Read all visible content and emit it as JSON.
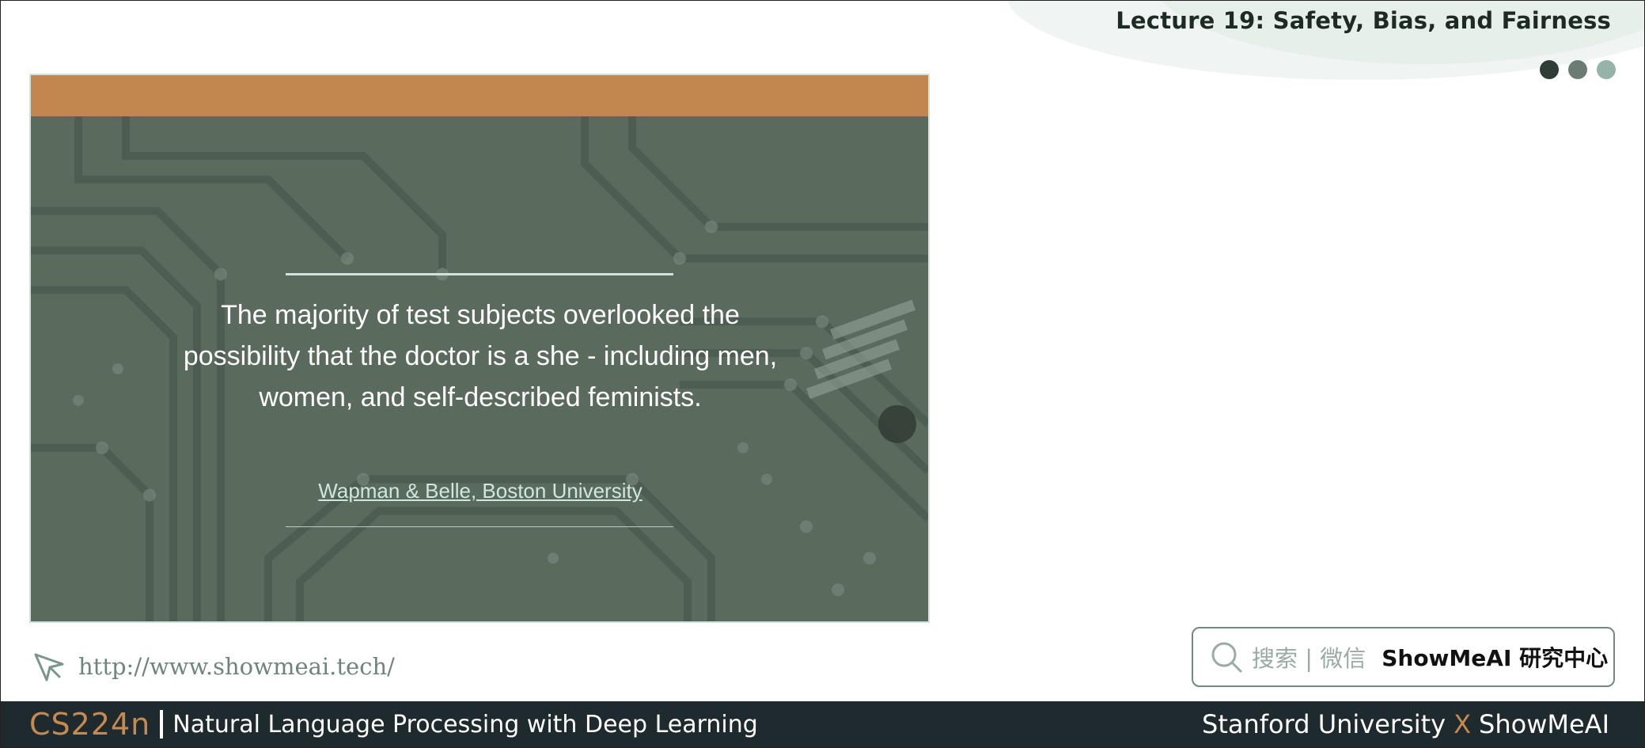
{
  "header": {
    "lecture_title": "Lecture 19: Safety, Bias, and Fairness",
    "dot_colors": [
      "#2f3d36",
      "#6b7c75",
      "#95b3a8"
    ]
  },
  "slide": {
    "bar_color": "#c2864f",
    "quote": "The majority of test subjects overlooked the possibility that the doctor is a she - including men, women, and self-described feminists.",
    "source_link": "Wapman & Belle, Boston University"
  },
  "footer_links": {
    "url": "http://www.showmeai.tech/",
    "search_hint": "搜索 | 微信",
    "search_brand": "ShowMeAI 研究中心"
  },
  "footer": {
    "course_code": "CS224n",
    "course_name": "Natural Language Processing with Deep Learning",
    "university": "Stanford University",
    "x": "X",
    "brand": "ShowMeAI"
  },
  "colors": {
    "accent": "#c6894f",
    "footer_bg": "#1f2a2e"
  }
}
